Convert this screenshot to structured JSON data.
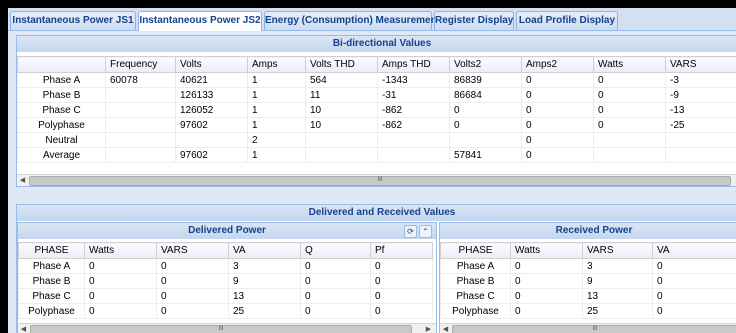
{
  "tabs": [
    {
      "label": "Instantaneous Power JS1"
    },
    {
      "label": "Instantaneous Power JS2"
    },
    {
      "label": "Energy (Consumption) Measurements"
    },
    {
      "label": "Register Display"
    },
    {
      "label": "Load Profile Display"
    }
  ],
  "bidirectional": {
    "title": "Bi-directional Values",
    "columns": [
      "",
      "Frequency",
      "Volts",
      "Amps",
      "Volts THD",
      "Amps THD",
      "Volts2",
      "Amps2",
      "Watts",
      "VARS"
    ],
    "rows": [
      [
        "Phase A",
        "60078",
        "40621",
        "1",
        "564",
        "-1343",
        "86839",
        "0",
        "0",
        "-3"
      ],
      [
        "Phase B",
        "",
        "126133",
        "1",
        "11",
        "-31",
        "86684",
        "0",
        "0",
        "-9"
      ],
      [
        "Phase C",
        "",
        "126052",
        "1",
        "10",
        "-862",
        "0",
        "0",
        "0",
        "-13"
      ],
      [
        "Polyphase",
        "",
        "97602",
        "1",
        "10",
        "-862",
        "0",
        "0",
        "0",
        "-25"
      ],
      [
        "Neutral",
        "",
        "",
        "2",
        "",
        "",
        "",
        "0",
        "",
        ""
      ],
      [
        "Average",
        "",
        "97602",
        "1",
        "",
        "",
        "57841",
        "0",
        "",
        ""
      ]
    ]
  },
  "delivered_received": {
    "title": "Delivered and Received Values",
    "delivered": {
      "title": "Delivered Power",
      "columns": [
        "PHASE",
        "Watts",
        "VARS",
        "VA",
        "Q",
        "Pf"
      ],
      "rows": [
        [
          "Phase A",
          "0",
          "0",
          "3",
          "0",
          "0"
        ],
        [
          "Phase B",
          "0",
          "0",
          "9",
          "0",
          "0"
        ],
        [
          "Phase C",
          "0",
          "0",
          "13",
          "0",
          "0"
        ],
        [
          "Polyphase",
          "0",
          "0",
          "25",
          "0",
          "0"
        ]
      ]
    },
    "received": {
      "title": "Received Power",
      "columns": [
        "PHASE",
        "Watts",
        "VARS",
        "VA"
      ],
      "rows": [
        [
          "Phase A",
          "0",
          "3",
          "0"
        ],
        [
          "Phase B",
          "0",
          "9",
          "0"
        ],
        [
          "Phase C",
          "0",
          "13",
          "0"
        ],
        [
          "Polyphase",
          "0",
          "25",
          "0"
        ]
      ]
    }
  },
  "scroll_grip": "III",
  "icons": {
    "refresh": "refresh-icon",
    "collapse": "collapse-icon",
    "left": "arrow-left-icon",
    "right": "arrow-right-icon"
  }
}
